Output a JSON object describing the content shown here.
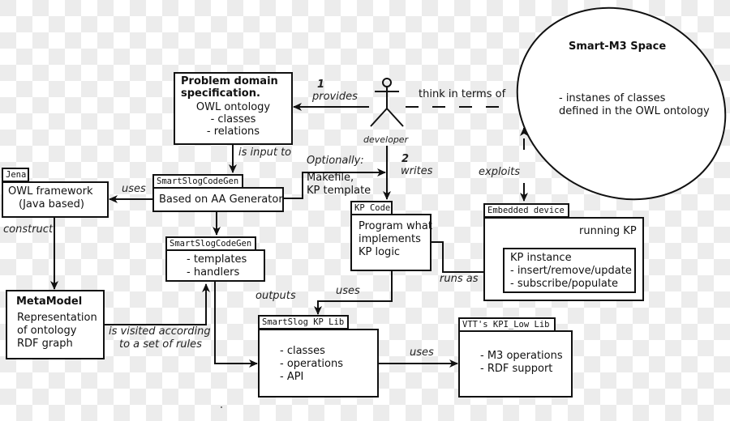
{
  "diagram": {
    "problem_domain": {
      "title_line1": "Problem domain",
      "title_line2": "specification.",
      "lines": [
        "OWL ontology",
        "- classes",
        "- relations"
      ]
    },
    "developer": {
      "label": "developer"
    },
    "edges": {
      "provides_num": "1",
      "provides": "provides",
      "think_in_terms_of": "think in terms of",
      "is_input_to": "is input to",
      "optionally": "Optionally:",
      "makefile_line1": "Makefile,",
      "makefile_line2": "KP template",
      "writes_num": "2",
      "writes": "writes",
      "exploits": "exploits",
      "uses_jena": "uses",
      "construct": "construct",
      "runs_as": "runs as",
      "uses_kplib": "uses",
      "outputs": "outputs",
      "visited_line1": "is visited according",
      "visited_line2": "to a set of rules",
      "uses_lowlib": "uses"
    },
    "smart_m3_space": {
      "title": "Smart-M3 Space",
      "line1": "- instanes of classes",
      "line2": "defined in the OWL ontology"
    },
    "jena": {
      "tab": "Jena",
      "line1": "OWL framework",
      "line2": "(Java based)"
    },
    "codegen_main": {
      "tab": "SmartSlogCodeGen",
      "text": "Based on AA Generator"
    },
    "codegen_templates": {
      "tab": "SmartSlogCodeGen",
      "lines": [
        "- templates",
        "- handlers"
      ]
    },
    "kp_code": {
      "tab": "KP Code",
      "lines": [
        "Program what",
        "implements",
        "KP logic"
      ]
    },
    "embedded_device": {
      "tab": "Embedded device",
      "label": "running KP",
      "kp_instance": {
        "title": "KP instance",
        "lines": [
          "- insert/remove/update",
          "- subscribe/populate"
        ]
      }
    },
    "metamodel": {
      "title": "MetaModel",
      "lines": [
        "Representation",
        "of ontology",
        "RDF graph"
      ]
    },
    "kp_lib": {
      "tab": "SmartSlog KP Lib",
      "lines": [
        "- classes",
        "- operations",
        "- API"
      ]
    },
    "low_lib": {
      "tab": "VTT's KPI_Low Lib",
      "lines": [
        "- M3 operations",
        "- RDF support"
      ]
    }
  }
}
